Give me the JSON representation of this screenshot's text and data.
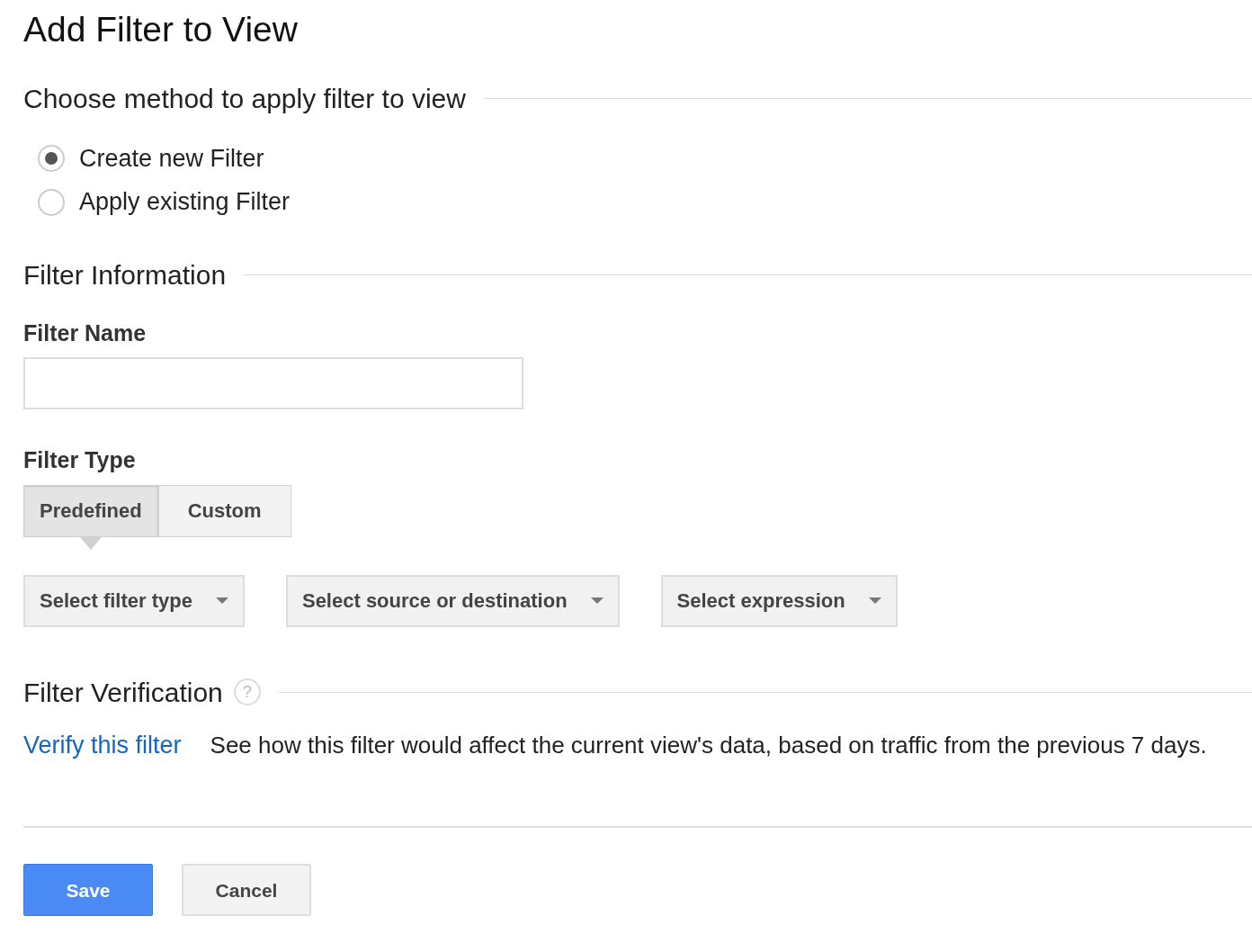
{
  "title": "Add Filter to View",
  "method_section": {
    "heading": "Choose method to apply filter to view",
    "options": [
      {
        "label": "Create new Filter",
        "selected": true
      },
      {
        "label": "Apply existing Filter",
        "selected": false
      }
    ]
  },
  "info_section": {
    "heading": "Filter Information",
    "name_label": "Filter Name",
    "type_label": "Filter Type",
    "tabs": [
      {
        "label": "Predefined",
        "selected": true
      },
      {
        "label": "Custom",
        "selected": false
      }
    ],
    "dropdowns": [
      {
        "label": "Select filter type"
      },
      {
        "label": "Select source or destination"
      },
      {
        "label": "Select expression"
      }
    ]
  },
  "verification_section": {
    "heading": "Filter Verification",
    "help_symbol": "?",
    "link": "Verify this filter",
    "description": "See how this filter would affect the current view's data, based on traffic from the previous 7 days."
  },
  "buttons": [
    {
      "label": "Save",
      "kind": "primary"
    },
    {
      "label": "Cancel",
      "kind": "secondary"
    }
  ]
}
